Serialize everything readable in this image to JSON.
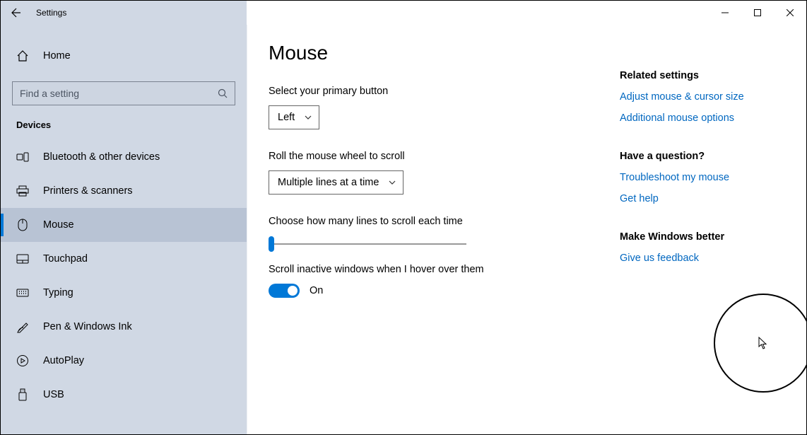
{
  "window": {
    "title": "Settings",
    "minimize": "–",
    "maximize": "☐",
    "close": "✕"
  },
  "sidebar": {
    "home": "Home",
    "searchPlaceholder": "Find a setting",
    "category": "Devices",
    "items": [
      {
        "icon": "bluetooth",
        "label": "Bluetooth & other devices"
      },
      {
        "icon": "printer",
        "label": "Printers & scanners"
      },
      {
        "icon": "mouse",
        "label": "Mouse",
        "active": true
      },
      {
        "icon": "touchpad",
        "label": "Touchpad"
      },
      {
        "icon": "typing",
        "label": "Typing"
      },
      {
        "icon": "pen",
        "label": "Pen & Windows Ink"
      },
      {
        "icon": "autoplay",
        "label": "AutoPlay"
      },
      {
        "icon": "usb",
        "label": "USB"
      }
    ]
  },
  "page": {
    "title": "Mouse",
    "primaryButtonLabel": "Select your primary button",
    "primaryButtonValue": "Left",
    "scrollModeLabel": "Roll the mouse wheel to scroll",
    "scrollModeValue": "Multiple lines at a time",
    "linesLabel": "Choose how many lines to scroll each time",
    "inactiveLabel": "Scroll inactive windows when I hover over them",
    "inactiveValue": "On"
  },
  "aside": {
    "related": {
      "heading": "Related settings",
      "links": [
        "Adjust mouse & cursor size",
        "Additional mouse options"
      ]
    },
    "question": {
      "heading": "Have a question?",
      "links": [
        "Troubleshoot my mouse",
        "Get help"
      ]
    },
    "better": {
      "heading": "Make Windows better",
      "links": [
        "Give us feedback"
      ]
    }
  }
}
